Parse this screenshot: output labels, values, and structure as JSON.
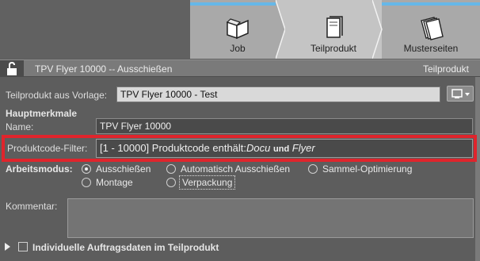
{
  "tabs": [
    {
      "label": "Job",
      "icon": "book-icon"
    },
    {
      "label": "Teilprodukt",
      "icon": "pages-icon"
    },
    {
      "label": "Musterseiten",
      "icon": "stacked-pages-icon"
    }
  ],
  "header": {
    "title": "TPV Flyer 10000 -- Ausschießen",
    "right_label": "Teilprodukt",
    "lock_icon": "unlock-icon"
  },
  "vorlage": {
    "label": "Teilprodukt aus Vorlage:",
    "value": "TPV Flyer 10000 - Test"
  },
  "section_title": "Hauptmerkmale",
  "name": {
    "label": "Name:",
    "value": "TPV Flyer 10000"
  },
  "produktcode": {
    "label": "Produktcode-Filter:",
    "prefix": "[1 - 10000] Produktcode enthält:",
    "term1": "Docu",
    "joiner": "und",
    "term2": "Flyer"
  },
  "arbeitsmodus": {
    "label": "Arbeitsmodus:",
    "options": [
      {
        "label": "Ausschießen",
        "selected": true
      },
      {
        "label": "Automatisch Ausschießen",
        "selected": false
      },
      {
        "label": "Sammel-Optimierung",
        "selected": false
      },
      {
        "label": "Montage",
        "selected": false
      },
      {
        "label": "Verpackung",
        "selected": false
      }
    ]
  },
  "kommentar": {
    "label": "Kommentar:",
    "value": ""
  },
  "footer": {
    "label": "Individuelle Auftragsdaten im Teilprodukt",
    "checked": false
  },
  "colors": {
    "highlight": "#e0242c",
    "accent": "#66b7e8",
    "background": "#5d5d5d"
  }
}
